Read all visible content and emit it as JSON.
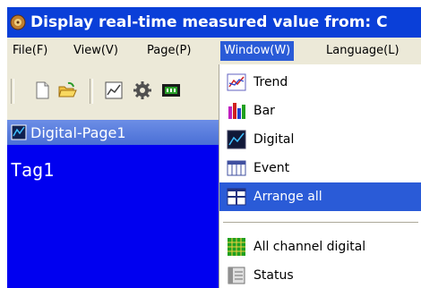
{
  "window": {
    "title": "Display real-time measured value from: C",
    "title_color": "#0a3fd8"
  },
  "menubar": {
    "items": [
      {
        "label": "File(F)"
      },
      {
        "label": "View(V)"
      },
      {
        "label": "Page(P)"
      },
      {
        "label": "Window(W)",
        "active": true
      },
      {
        "label": "Language(L)"
      }
    ]
  },
  "toolbar": {
    "buttons": [
      "new-document-icon",
      "open-folder-icon",
      "chart-icon",
      "gear-icon",
      "meter-icon"
    ]
  },
  "document": {
    "tab_title": "Digital-Page1",
    "tag": "Tag1",
    "background": "#0000f0"
  },
  "window_menu": {
    "items": [
      {
        "label": "Trend",
        "icon": "trend-icon"
      },
      {
        "label": "Bar",
        "icon": "bar-icon"
      },
      {
        "label": "Digital",
        "icon": "digital-icon"
      },
      {
        "label": "Event",
        "icon": "event-icon"
      },
      {
        "label": "Arrange all",
        "icon": "arrange-all-icon",
        "highlighted": true
      },
      {
        "label": "All channel digital",
        "icon": "all-channel-digital-icon"
      },
      {
        "label": "Status",
        "icon": "status-icon"
      }
    ]
  }
}
